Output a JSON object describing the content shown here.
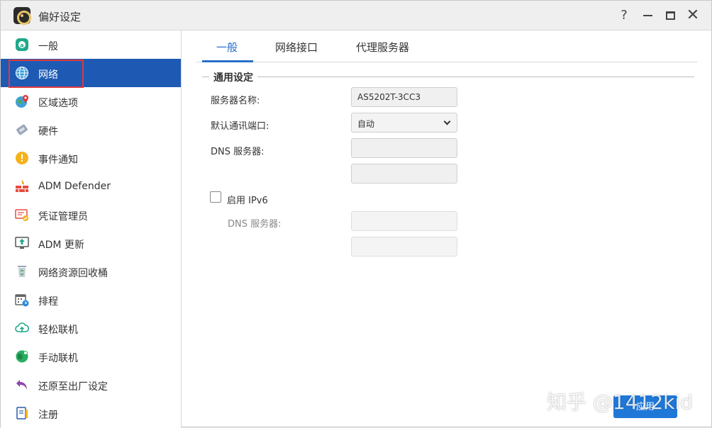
{
  "window": {
    "title": "偏好设定"
  },
  "sidebar": {
    "items": [
      {
        "label": "一般",
        "icon": "general-icon"
      },
      {
        "label": "网络",
        "icon": "globe-icon"
      },
      {
        "label": "区域选项",
        "icon": "region-icon"
      },
      {
        "label": "硬件",
        "icon": "hardware-icon"
      },
      {
        "label": "事件通知",
        "icon": "notification-icon"
      },
      {
        "label": "ADM Defender",
        "icon": "firewall-icon"
      },
      {
        "label": "凭证管理员",
        "icon": "certificate-icon"
      },
      {
        "label": "ADM 更新",
        "icon": "update-icon"
      },
      {
        "label": "网络资源回收桶",
        "icon": "recycle-bin-icon"
      },
      {
        "label": "排程",
        "icon": "schedule-icon"
      },
      {
        "label": "轻松联机",
        "icon": "cloud-connect-icon"
      },
      {
        "label": "手动联机",
        "icon": "manual-connect-icon"
      },
      {
        "label": "还原至出厂设定",
        "icon": "restore-icon"
      },
      {
        "label": "注册",
        "icon": "register-icon"
      }
    ],
    "active_index": 1
  },
  "tabs": [
    {
      "label": "一般"
    },
    {
      "label": "网络接口"
    },
    {
      "label": "代理服务器"
    }
  ],
  "general": {
    "section_title": "通用设定",
    "server_name_label": "服务器名称:",
    "server_name_value": "AS5202T-3CC3",
    "default_port_label": "默认通讯端口:",
    "default_port_value": "自动",
    "dns_label": "DNS 服务器:",
    "dns1_value": "",
    "dns2_value": "",
    "ipv6_checkbox_label": "启用 IPv6",
    "ipv6_checked": false,
    "ipv6_dns_label": "DNS 服务器:",
    "ipv6_dns1_value": "",
    "ipv6_dns2_value": ""
  },
  "footer": {
    "apply_label": "应用"
  },
  "watermark": "知乎 @1412kid",
  "colors": {
    "accent": "#1e5ab3",
    "tab_active": "#2a6fc9",
    "apply": "#1f78d8",
    "highlight": "#e0393e"
  }
}
